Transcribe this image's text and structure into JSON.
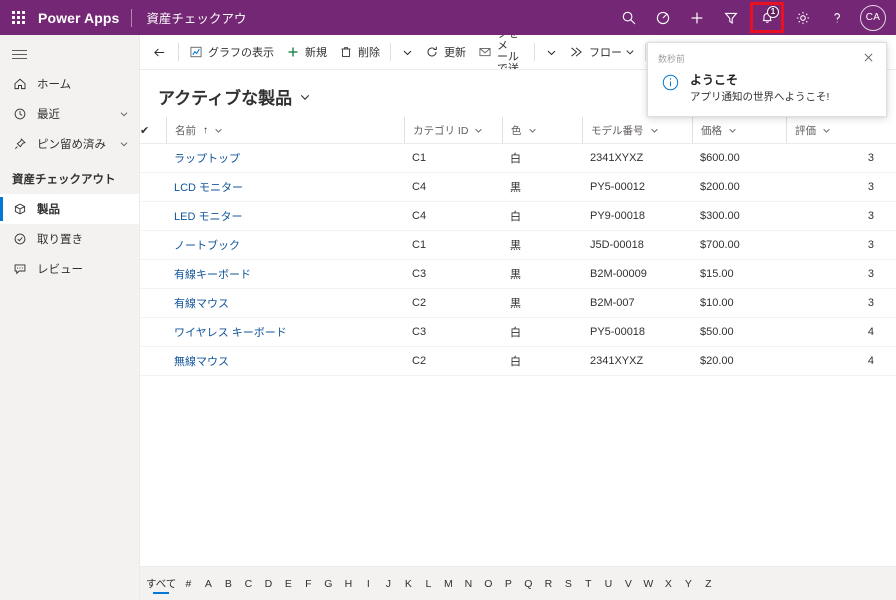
{
  "header": {
    "waffle_label": "app-launcher",
    "brand": "Power Apps",
    "app_title": "資産チェックアウ",
    "actions": [
      {
        "name": "search-icon",
        "label": "検索"
      },
      {
        "name": "target-icon",
        "label": "パーソナル設定"
      },
      {
        "name": "plus-icon",
        "label": "新規"
      },
      {
        "name": "filter-icon",
        "label": "フィルター"
      }
    ],
    "notification_badge": "1",
    "settings_label": "設定",
    "help_label": "ヘルプ",
    "avatar_initials": "CA",
    "brand_color": "#742774",
    "highlight_color": "#e81123"
  },
  "sidebar": {
    "hamburger_label": "メニュー",
    "items": [
      {
        "label": "ホーム",
        "icon": "home-icon",
        "chevron": false,
        "selected": false
      },
      {
        "label": "最近",
        "icon": "clock-icon",
        "chevron": true,
        "selected": false
      },
      {
        "label": "ピン留め済み",
        "icon": "pin-icon",
        "chevron": true,
        "selected": false
      }
    ],
    "group_title": "資産チェックアウト",
    "group_items": [
      {
        "label": "製品",
        "icon": "cube-icon",
        "selected": true
      },
      {
        "label": "取り置き",
        "icon": "check-circle-icon",
        "selected": false
      },
      {
        "label": "レビュー",
        "icon": "comment-icon",
        "selected": false
      }
    ]
  },
  "commandbar": {
    "back_label": "戻る",
    "commands": [
      {
        "label": "グラフの表示",
        "icon": "chart-icon"
      },
      {
        "label": "新規",
        "icon": "plus-icon"
      },
      {
        "label": "削除",
        "icon": "trash-icon"
      }
    ],
    "overflow_label": "その他のコマンド",
    "refresh_label": "更新",
    "email_link_label_line1": "リンクをメ",
    "email_link_label_line2": "ールで送信",
    "flow_label": "フロー"
  },
  "view": {
    "title": "アクティブな製品",
    "chevron": "chevron-down"
  },
  "table": {
    "select_all_label": "すべて選択",
    "columns": [
      {
        "key": "name",
        "label": "名前",
        "sorted": true,
        "sort_dir": "↑"
      },
      {
        "key": "category",
        "label": "カテゴリ ID",
        "sorted": false
      },
      {
        "key": "color",
        "label": "色",
        "sorted": false
      },
      {
        "key": "model",
        "label": "モデル番号",
        "sorted": false
      },
      {
        "key": "price",
        "label": "価格",
        "sorted": false
      },
      {
        "key": "rating",
        "label": "評価",
        "sorted": false
      }
    ],
    "rows": [
      {
        "name": "ラップトップ",
        "category": "C1",
        "color": "白",
        "model": "2341XYXZ",
        "price": "$600.00",
        "rating": "3"
      },
      {
        "name": "LCD モニター",
        "category": "C4",
        "color": "黒",
        "model": "PY5-00012",
        "price": "$200.00",
        "rating": "3"
      },
      {
        "name": "LED モニター",
        "category": "C4",
        "color": "白",
        "model": "PY9-00018",
        "price": "$300.00",
        "rating": "3"
      },
      {
        "name": "ノートブック",
        "category": "C1",
        "color": "黒",
        "model": "J5D-00018",
        "price": "$700.00",
        "rating": "3"
      },
      {
        "name": "有線キーボード",
        "category": "C3",
        "color": "黒",
        "model": "B2M-00009",
        "price": "$15.00",
        "rating": "3"
      },
      {
        "name": "有線マウス",
        "category": "C2",
        "color": "黒",
        "model": "B2M-007",
        "price": "$10.00",
        "rating": "3"
      },
      {
        "name": "ワイヤレス キーボード",
        "category": "C3",
        "color": "白",
        "model": "PY5-00018",
        "price": "$50.00",
        "rating": "4"
      },
      {
        "name": "無線マウス",
        "category": "C2",
        "color": "白",
        "model": "2341XYXZ",
        "price": "$20.00",
        "rating": "4"
      }
    ]
  },
  "alphabar": {
    "all_label": "すべて",
    "letters": [
      "#",
      "A",
      "B",
      "C",
      "D",
      "E",
      "F",
      "G",
      "H",
      "I",
      "J",
      "K",
      "L",
      "M",
      "N",
      "O",
      "P",
      "Q",
      "R",
      "S",
      "T",
      "U",
      "V",
      "W",
      "X",
      "Y",
      "Z"
    ],
    "active": "すべて"
  },
  "notification": {
    "time": "数秒前",
    "title": "ようこそ",
    "message": "アプリ通知の世界へようこそ!",
    "close_label": "閉じる"
  }
}
